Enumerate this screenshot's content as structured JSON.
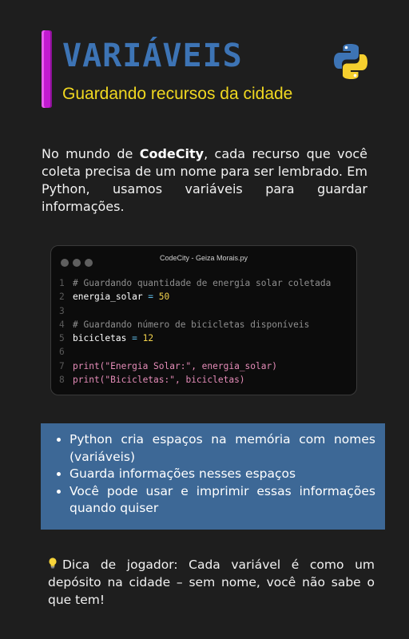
{
  "header": {
    "title": "VARIÁVEIS",
    "subtitle": "Guardando recursos da cidade",
    "logo_icon": "python-logo-icon",
    "accent_color": "#c21bd0",
    "title_color": "#3d74b5",
    "subtitle_color": "#f1d820"
  },
  "intro": {
    "prefix": "No mundo de ",
    "brand": "CodeCity",
    "suffix": ", cada recurso que você coleta precisa de um nome para ser lembrado. Em Python, usamos variáveis para guardar informações."
  },
  "code_window": {
    "title": "CodeCity - Geiza Morais.py",
    "lines": [
      {
        "n": "1",
        "comment": "# Guardando quantidade de energia solar coletada"
      },
      {
        "n": "2",
        "var": "energia_solar",
        "op": " = ",
        "value": "50"
      },
      {
        "n": "3"
      },
      {
        "n": "4",
        "comment": "# Guardando número de bicicletas disponíveis"
      },
      {
        "n": "5",
        "var": "bicicletas",
        "op": " = ",
        "value": "12"
      },
      {
        "n": "6"
      },
      {
        "n": "7",
        "fn": "print(",
        "str": "\"Energia Solar:\"",
        "arg": ", energia_solar)"
      },
      {
        "n": "8",
        "fn": "print(",
        "str": "\"Bicicletas:\"",
        "arg": ", bicicletas)"
      }
    ]
  },
  "tips_box": {
    "items": [
      "Python cria espaços na memória com nomes (variáveis)",
      "Guarda informações nesses espaços",
      "Você pode usar e imprimir essas informações quando quiser"
    ],
    "background": "#3d6896"
  },
  "player_tip": {
    "icon": "lightbulb-icon",
    "text": "Dica de jogador: Cada variável é como um depósito na cidade – sem nome, você não sabe o que tem!"
  }
}
